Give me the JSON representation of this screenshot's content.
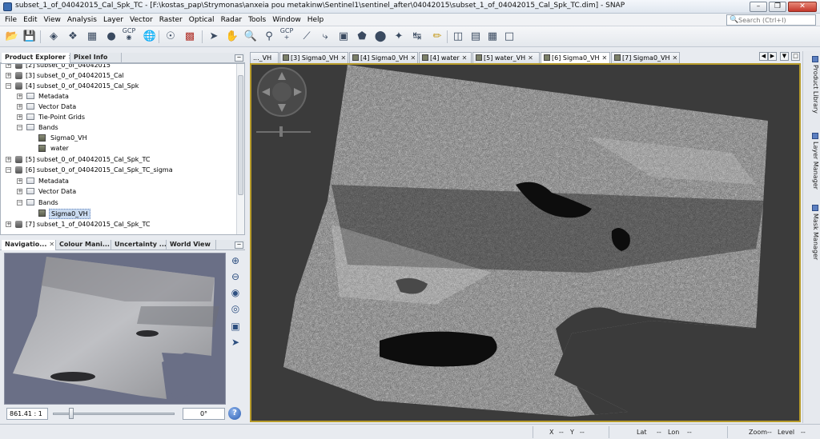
{
  "window": {
    "title": "subset_1_of_04042015_Cal_Spk_TC - [F:\\kostas_pap\\Strymonas\\anxeia pou metakinw\\Sentinel1\\sentinel_after\\04042015\\subset_1_of_04042015_Cal_Spk_TC.dim] - SNAP"
  },
  "menu": [
    "File",
    "Edit",
    "View",
    "Analysis",
    "Layer",
    "Vector",
    "Raster",
    "Optical",
    "Radar",
    "Tools",
    "Window",
    "Help"
  ],
  "search": {
    "placeholder": "Search (Ctrl+I)"
  },
  "toolbar": {
    "gcp1": "GCP",
    "gcp2": "GCP"
  },
  "product_panel": {
    "tabs": [
      "Product Explorer",
      "Pixel Info"
    ],
    "tree": [
      {
        "label": "[2] subset_0_of_04042015"
      },
      {
        "label": "[3] subset_0_of_04042015_Cal"
      },
      {
        "label": "[4] subset_0_of_04042015_Cal_Spk"
      },
      {
        "label": "Metadata"
      },
      {
        "label": "Vector Data"
      },
      {
        "label": "Tie-Point Grids"
      },
      {
        "label": "Bands"
      },
      {
        "label": "Sigma0_VH"
      },
      {
        "label": "water"
      },
      {
        "label": "[5] subset_0_of_04042015_Cal_Spk_TC"
      },
      {
        "label": "[6] subset_0_of_04042015_Cal_Spk_TC_sigma"
      },
      {
        "label": "Metadata"
      },
      {
        "label": "Vector Data"
      },
      {
        "label": "Bands"
      },
      {
        "label": "Sigma0_VH"
      },
      {
        "label": "[7] subset_1_of_04042015_Cal_Spk_TC"
      }
    ]
  },
  "nav_panel": {
    "tabs": [
      "Navigatio...",
      "Colour Mani...",
      "Uncertainty ...",
      "World View"
    ],
    "zoom_value": "861.41 : 1",
    "angle_value": "0°",
    "help_label": "?"
  },
  "image_tabs": [
    {
      "label": "..._VH"
    },
    {
      "label": "[3] Sigma0_VH"
    },
    {
      "label": "[4] Sigma0_VH"
    },
    {
      "label": "[4] water"
    },
    {
      "label": "[5] water_VH"
    },
    {
      "label": "[6] Sigma0_VH"
    },
    {
      "label": "[7] Sigma0_VH"
    }
  ],
  "active_image_tab": "[6] Sigma0_VH",
  "side_tabs": [
    "Product Library",
    "Layer Manager",
    "Mask Manager"
  ],
  "status": {
    "x_label": "X",
    "x_value": "--",
    "y_label": "Y",
    "y_value": "--",
    "lat_label": "Lat",
    "lat_value": "--",
    "lon_label": "Lon",
    "lon_value": "--",
    "zoom_label": "Zoom",
    "zoom_value": "--",
    "level_label": "Level",
    "level_value": "--"
  },
  "colors": {
    "accent": "#b79b2a",
    "image_background": "#3b3b3b",
    "nav_background": "#6a6f86"
  }
}
